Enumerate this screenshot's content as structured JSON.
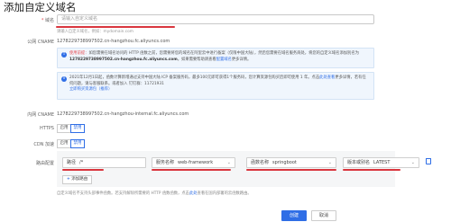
{
  "page": {
    "title": "添加自定义域名"
  },
  "domain": {
    "label": "域名",
    "placeholder": "请输入自定义域名",
    "hint": "请输入自定义域名，例如：mydomain.com"
  },
  "public_cname": {
    "label": "公网 CNAME",
    "value": "1278229738997502.cn-hangzhou.fc.aliyuncs.com"
  },
  "notice1": {
    "prefix": "使用前提：",
    "text": "如您需要在域名访问的 HTTP 函数之前，您需要将您的域名在阿里云中进行备案（仅限中国大陆），然后您需要在域名服务商处，将您的自定义域名添加别名为",
    "cname": "1278229738997502.cn-hangzhou.fc.aliyuncs.com",
    "link_pre": "。如果需要帮助请查看",
    "link": "配置域名",
    "link_post": "更多详情。"
  },
  "notice2": {
    "text": "2021年12月1日起，函数计算新增通过支持中国大陆 ICP 备案服务码，最多100元即可获得1个服务码，您计算资源包购买后即可使用 1 年。点击",
    "link1": "此处查看",
    "text2": "更多详情，若有任何问题，请与客服联系。或者加入 钉钉群：",
    "group": "11721931",
    "link2": "立即购买资源包（推荐）"
  },
  "internal_cname": {
    "label": "内网 CNAME",
    "value": "1278229738997502.cn-hangzhou-internal.fc.aliyuncs.com"
  },
  "https": {
    "label": "HTTPS",
    "options": [
      "启用",
      "禁用"
    ],
    "selected": "禁用"
  },
  "cdn": {
    "label": "CDN 加速",
    "options": [
      "启用",
      "禁用"
    ],
    "selected": "禁用"
  },
  "route": {
    "label": "路由配置",
    "path_label": "路径",
    "path_value": "/*",
    "service_label": "服务名称",
    "service_value": "web-framework",
    "function_label": "函数名称",
    "function_value": "springboot",
    "version_label": "版本或别名",
    "version_value": "LATEST",
    "add_label": "添加路由",
    "add_icon": "plus-icon",
    "delete_icon": "trash-icon"
  },
  "footer_hint": {
    "text": "自定义域名不支持头部事件函数。若支持解除所需要的 HTTP 函数函数，点击",
    "link": "此处",
    "text2": "查看在国内部署的云函数路由。"
  },
  "buttons": {
    "create": "创建",
    "cancel": "取消"
  },
  "colors": {
    "accent": "#2f6ee6",
    "annotation": "#d9363e",
    "notice_bg": "#f0f6fd"
  }
}
